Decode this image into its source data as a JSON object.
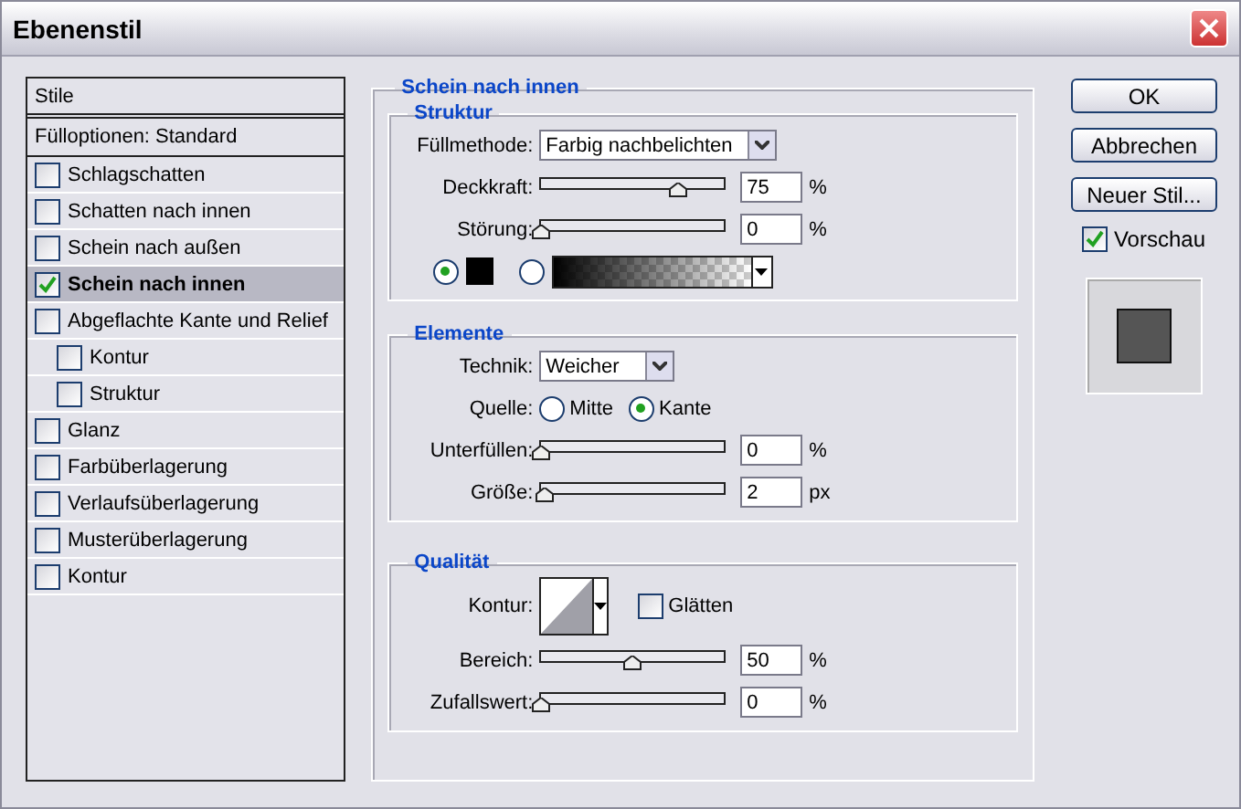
{
  "window": {
    "title": "Ebenenstil"
  },
  "styles_list": {
    "header": "Stile",
    "blend_options": "Fülloptionen: Standard",
    "items": [
      {
        "label": "Schlagschatten",
        "checked": false,
        "selected": false
      },
      {
        "label": "Schatten nach innen",
        "checked": false,
        "selected": false
      },
      {
        "label": "Schein nach außen",
        "checked": false,
        "selected": false
      },
      {
        "label": "Schein nach innen",
        "checked": true,
        "selected": true
      },
      {
        "label": "Abgeflachte Kante und Relief",
        "checked": false,
        "selected": false,
        "children": [
          {
            "label": "Kontur",
            "checked": false,
            "selected": false
          },
          {
            "label": "Struktur",
            "checked": false,
            "selected": false
          }
        ]
      },
      {
        "label": "Glanz",
        "checked": false,
        "selected": false
      },
      {
        "label": "Farbüberlagerung",
        "checked": false,
        "selected": false
      },
      {
        "label": "Verlaufsüberlagerung",
        "checked": false,
        "selected": false
      },
      {
        "label": "Musterüberlagerung",
        "checked": false,
        "selected": false
      },
      {
        "label": "Kontur",
        "checked": false,
        "selected": false
      }
    ]
  },
  "panel": {
    "title": "Schein nach innen",
    "sections": [
      {
        "title": "Struktur",
        "rows": [
          {
            "kind": "select",
            "label": "Füllmethode:",
            "value": "Farbig nachbelichten"
          },
          {
            "kind": "slider",
            "label": "Deckkraft:",
            "level": 0.75,
            "value": "75",
            "unit": "%"
          },
          {
            "kind": "slider",
            "label": "Störung:",
            "level": 0,
            "value": "0",
            "unit": "%"
          },
          {
            "kind": "fill",
            "options": [
              {
                "kind": "color",
                "selected": true
              },
              {
                "kind": "gradient",
                "selected": false
              }
            ]
          }
        ]
      },
      {
        "title": "Elemente",
        "rows": [
          {
            "kind": "select",
            "label": "Technik:",
            "value": "Weicher"
          },
          {
            "kind": "radio",
            "label": "Quelle:",
            "options": [
              {
                "label": "Mitte",
                "selected": false
              },
              {
                "label": "Kante",
                "selected": true
              }
            ]
          },
          {
            "kind": "slider",
            "label": "Unterfüllen:",
            "level": 0,
            "value": "0",
            "unit": "%"
          },
          {
            "kind": "slider",
            "label": "Größe:",
            "level": 0.02,
            "value": "2",
            "unit": "px"
          }
        ]
      },
      {
        "title": "Qualität",
        "rows": [
          {
            "kind": "contour",
            "label": "Kontur:",
            "checkbox": {
              "label": "Glätten",
              "checked": false
            }
          },
          {
            "kind": "slider",
            "label": "Bereich:",
            "level": 0.5,
            "value": "50",
            "unit": "%"
          },
          {
            "kind": "slider",
            "label": "Zufallswert:",
            "level": 0,
            "value": "0",
            "unit": "%"
          }
        ]
      }
    ]
  },
  "buttons": [
    "OK",
    "Abbrechen",
    "Neuer Stil..."
  ],
  "preview": {
    "label": "Vorschau",
    "checked": true
  }
}
